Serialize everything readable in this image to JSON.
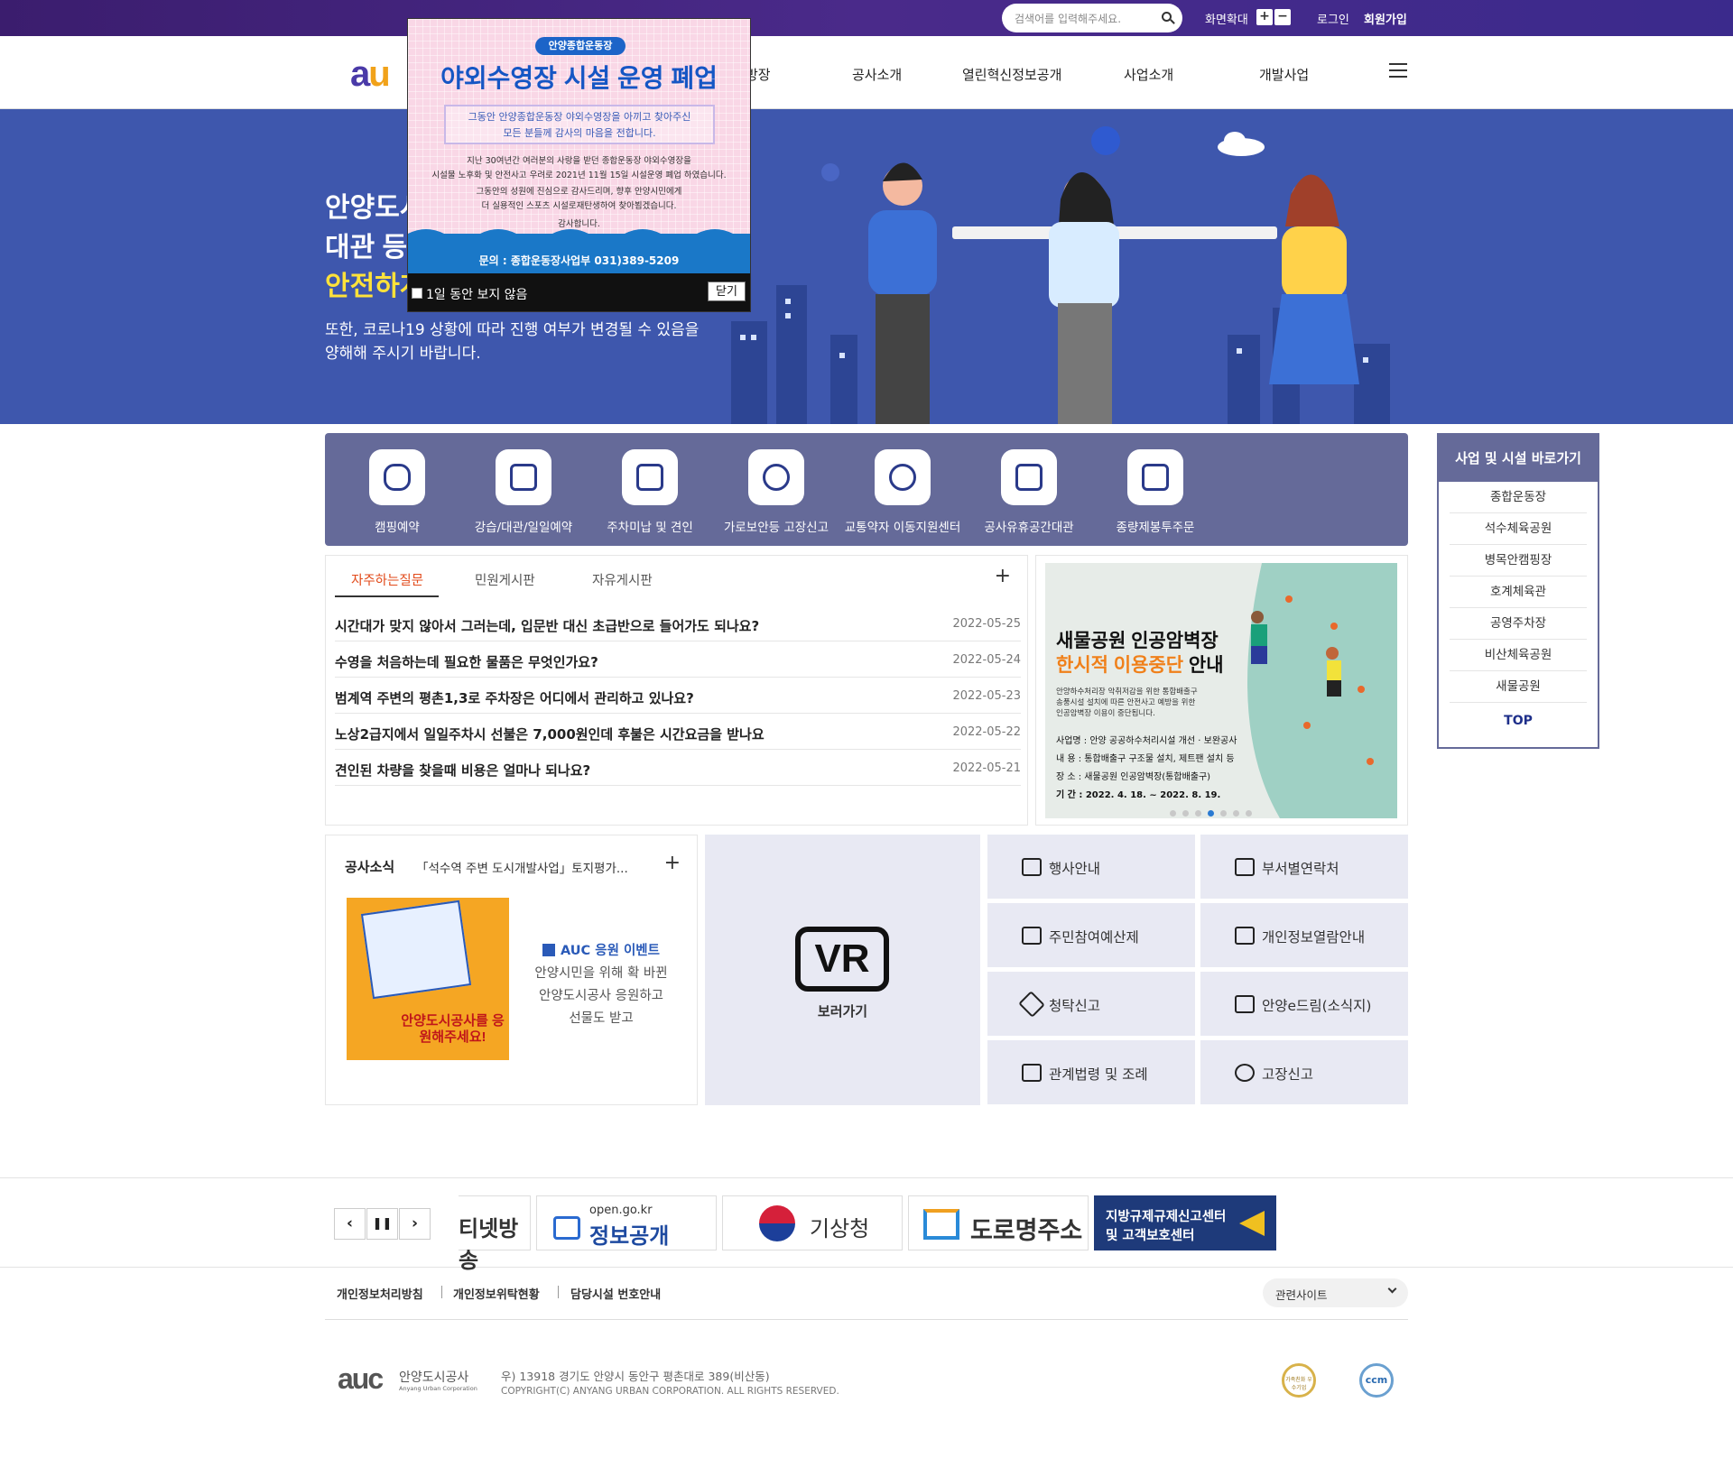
{
  "util": {
    "search_placeholder": "검색어를 입력해주세요.",
    "zoom_label": "화면확대",
    "zoom_in": "+",
    "zoom_out": "−",
    "login": "로그인",
    "signup": "회원가입"
  },
  "header": {
    "logo": "auc",
    "nav": [
      "방장",
      "공사소개",
      "열린혁신정보공개",
      "사업소개",
      "개발사업"
    ]
  },
  "hero": {
    "line1": "안양도시",
    "line2": "대관 등",
    "line3": "안전하게",
    "sub1": "또한, 코로나19 상황에 따라 진행 여부가 변경될 수 있음을",
    "sub2": "양해해 주시기 바랍니다."
  },
  "popup": {
    "badge": "안양종합운동장",
    "title": "야외수영장 시설 운영 폐업",
    "box_line1": "그동안 안양종합운동장 야외수영장을 아끼고 찾아주신",
    "box_line2": "모든 분들께 감사의 마음을 전합니다.",
    "para1": "지난 30여년간 여러분의 사랑을 받던 종합운동장 야외수영장을",
    "para2": "시설물 노후화 및 안전사고 우려로 2021년 11월 15일 시설운영 폐업 하였습니다.",
    "para3": "그동안의 성원에 진심으로 감사드리며, 향후 안양시민에게",
    "para4": "더 실용적인 스포츠 시설로재탄생하여 찾아뵙겠습니다.",
    "para5": "감사합니다.",
    "contact": "문의 : 종합운동장사업부 031)389-5209",
    "hide_today": "1일 동안 보지 않음",
    "close": "닫기"
  },
  "quick": {
    "items": [
      "캠핑예약",
      "강습/대관/일일예약",
      "주차미납 및 견인",
      "가로보안등 고장신고",
      "교통약자 이동지원센터",
      "공사유휴공간대관",
      "종량제봉투주문"
    ]
  },
  "sidebox": {
    "title": "사업 및 시설 바로가기",
    "items": [
      "종합운동장",
      "석수체육공원",
      "병목안캠핑장",
      "호계체육관",
      "공영주차장",
      "비산체육공원",
      "새물공원"
    ],
    "top": "TOP"
  },
  "board": {
    "tabs": [
      "자주하는질문",
      "민원게시판",
      "자유게시판"
    ],
    "more": "+",
    "rows": [
      {
        "q": "시간대가 맞지 않아서 그러는데, 입문반 대신 초급반으로 들어가도 되나요?",
        "d": "2022-05-25"
      },
      {
        "q": "수영을 처음하는데 필요한 물품은 무엇인가요?",
        "d": "2022-05-24"
      },
      {
        "q": "범계역 주변의 평촌1,3로 주차장은 어디에서 관리하고 있나요?",
        "d": "2022-05-23"
      },
      {
        "q": "노상2급지에서 일일주차시 선불은 7,000원인데 후불은 시간요금을 받나요",
        "d": "2022-05-22"
      },
      {
        "q": "견인된 차량을 찾을때 비용은 얼마나 되나요?",
        "d": "2022-05-21"
      }
    ]
  },
  "promo": {
    "title1": "새물공원 인공암벽장",
    "title2_orange": "한시적 이용중단",
    "title2_rest": " 안내",
    "desc1": "안양하수처리장 악취저감을 위한 통합배출구",
    "desc2": "송풍시설 설치에 따른 안전사고 예방을 위한",
    "desc3": "인공암벽장 이용이 중단됩니다.",
    "info1": "사업명 : 안양 공공하수처리시설 개선 · 보완공사",
    "info2": "내  용 : 통합배출구 구조물 설치, 제트팬 설치 등",
    "info3": "장  소 : 새물공원 인공암벽장(통합배출구)",
    "info4": "기  간 : 2022. 4. 18. ~ 2022. 8. 19.",
    "dot_count": 7,
    "active_dot": 4
  },
  "news": {
    "title": "공사소식",
    "ticker": "「석수역 주변 도시개발사업」토지평가...",
    "more": "+",
    "cap1": "AUC 응원 이벤트",
    "cap2": "안양시민을 위해 확 바뀐",
    "cap3": "안양도시공사 응원하고",
    "cap4": "선물도 받고",
    "img_text": "안양도시공사를 응원해주세요!"
  },
  "vr": {
    "mark": "VR",
    "label": "보러가기"
  },
  "links": [
    {
      "label": "행사안내",
      "icon": "calendar-icon"
    },
    {
      "label": "부서별연락처",
      "icon": "contact-card-icon"
    },
    {
      "label": "주민참여예산제",
      "icon": "document-icon"
    },
    {
      "label": "개인정보열람안내",
      "icon": "lock-user-icon"
    },
    {
      "label": "청탁신고",
      "icon": "handshake-icon"
    },
    {
      "label": "안양e드림(소식지)",
      "icon": "mail-icon"
    },
    {
      "label": "관계법령 및 조례",
      "icon": "checklist-icon"
    },
    {
      "label": "고장신고",
      "icon": "wrench-icon"
    }
  ],
  "banners": {
    "b1": "티넷방송",
    "b2_small": "open.go.kr",
    "b2": "정보공개",
    "b3": "기상청",
    "b4": "도로명주소",
    "b5_line1": "지방규제규제신고센터",
    "b5_line2": "및 고객보호센터"
  },
  "footer": {
    "links": [
      "개인정보처리방침",
      "개인정보위탁현황",
      "담당시설 번호안내"
    ],
    "related": "관련사이트",
    "logo": "auc",
    "logo_text": "안양도시공사",
    "logo_sub": "Anyang Urban Corporation",
    "address": "우) 13918 경기도 안양시 동안구 평촌대로 389(비산동)",
    "copyright": "COPYRIGHT(C) ANYANG URBAN CORPORATION. ALL RIGHTS RESERVED.",
    "cert1": "가족친화 우수기업",
    "cert2": "ccm"
  },
  "colors": {
    "topbar": "#3b1d6e",
    "hero": "#3e57ad",
    "quick": "#656a99",
    "tile": "#e8e9f3",
    "accent_orange": "#e24a1a"
  }
}
